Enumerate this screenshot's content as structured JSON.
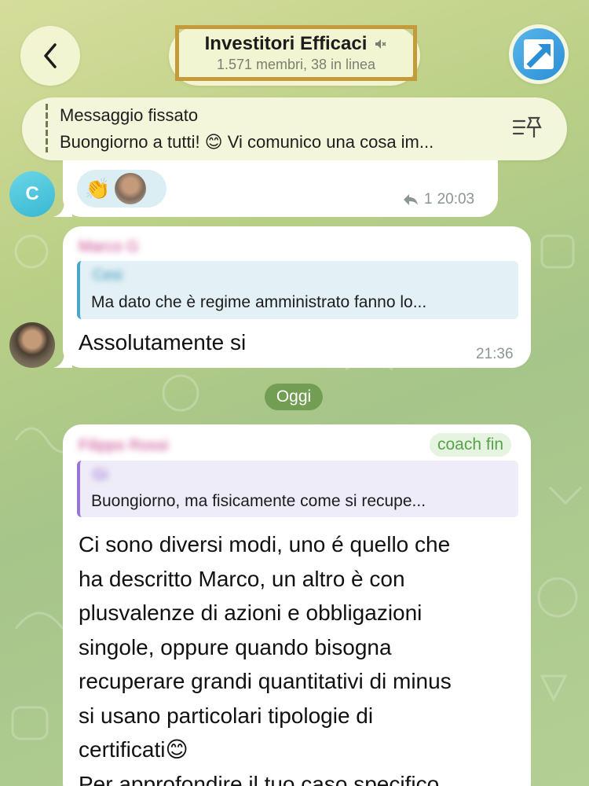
{
  "header": {
    "title": "Investitori Efficaci",
    "subtitle": "1.571 membri, 38 in linea",
    "mute_icon": "speaker-muted-icon",
    "back_icon": "chevron-left-icon",
    "group_avatar_icon": "arrow-up-right-icon"
  },
  "pinned": {
    "title": "Messaggio fissato",
    "text": "Buongiorno a tutti! 😊 Vi comunico una cosa im...",
    "icon": "pin-list-icon"
  },
  "messages": [
    {
      "avatar_letter": "C",
      "reaction_emoji": "👏",
      "reply_count": "1",
      "time": "20:03"
    },
    {
      "sender": "Marco G",
      "reply_name": "Cesi",
      "reply_text": "Ma dato che è regime amministrato fanno lo...",
      "body": "Assolutamente si",
      "time": "21:36"
    },
    {
      "sender": "Filippo Rossi",
      "badge": "coach fin",
      "reply_name": "Gi",
      "reply_text": "Buongiorno, ma fisicamente come si recupe...",
      "body_lines": [
        "Ci sono diversi modi, uno é quello che",
        "ha descritto Marco, un altro è con",
        "plusvalenze di azioni e obbligazioni",
        "singole, oppure quando bisogna",
        "recuperare grandi quantitativi di minus",
        "si usano particolari tipologie di",
        "certificati😊",
        "Per approfondire il tuo caso specifico"
      ]
    }
  ],
  "date_separator": "Oggi",
  "colors": {
    "title_highlight": "#c49a3a",
    "sender_name": "#c9488f",
    "badge_text": "#58a24a",
    "date_pill": "#68964a"
  }
}
